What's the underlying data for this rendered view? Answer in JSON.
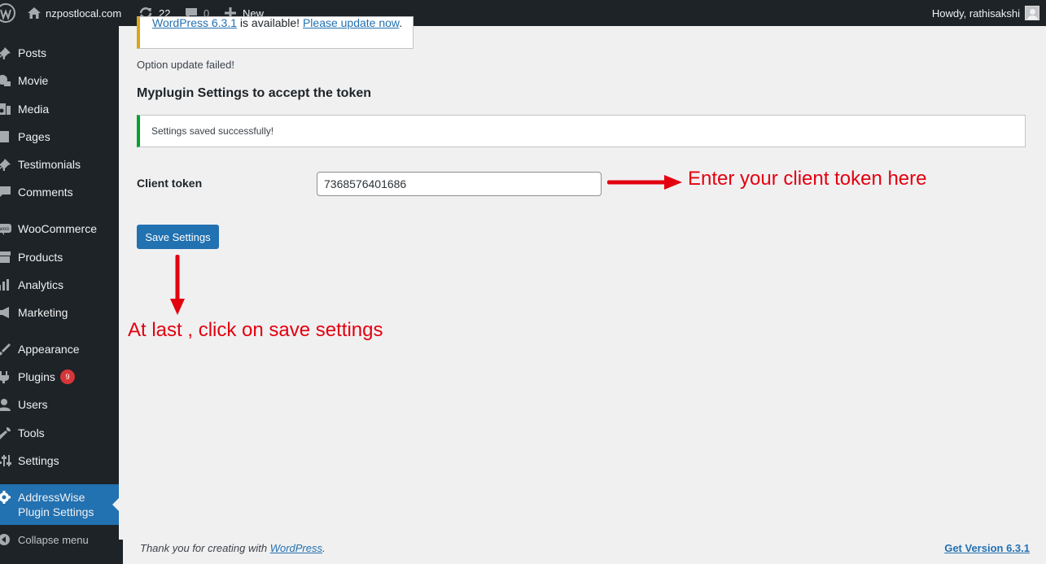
{
  "admin_bar": {
    "site_name": "nzpostlocal.com",
    "updates_count": "22",
    "comments_count": "0",
    "new_label": "New",
    "howdy": "Howdy, rathisakshi"
  },
  "sidebar": {
    "items": [
      {
        "label": "Posts",
        "icon": "pin-icon"
      },
      {
        "label": "Movie",
        "icon": "video-icon"
      },
      {
        "label": "Media",
        "icon": "media-icon"
      },
      {
        "label": "Pages",
        "icon": "pages-icon"
      },
      {
        "label": "Testimonials",
        "icon": "pin-icon"
      },
      {
        "label": "Comments",
        "icon": "comment-icon"
      },
      {
        "label": "WooCommerce",
        "icon": "woo-icon"
      },
      {
        "label": "Products",
        "icon": "archive-icon"
      },
      {
        "label": "Analytics",
        "icon": "chart-icon"
      },
      {
        "label": "Marketing",
        "icon": "megaphone-icon"
      },
      {
        "label": "Appearance",
        "icon": "brush-icon"
      },
      {
        "label": "Plugins",
        "icon": "plug-icon",
        "badge": "9"
      },
      {
        "label": "Users",
        "icon": "user-icon"
      },
      {
        "label": "Tools",
        "icon": "wrench-icon"
      },
      {
        "label": "Settings",
        "icon": "sliders-icon"
      },
      {
        "label": "AddressWise Plugin Settings",
        "icon": "gear-icon",
        "current": true
      }
    ],
    "collapse_label": "Collapse menu"
  },
  "main": {
    "nag": {
      "version_link": "WordPress 6.3.1",
      "middle_text": " is available! ",
      "update_link": "Please update now",
      "end_text": "."
    },
    "option_failed": "Option update failed!",
    "title": "Myplugin Settings to accept the token",
    "notice": "Settings saved successfully!",
    "field_label": "Client token",
    "token_value": "7368576401686",
    "save_label": "Save Settings",
    "annotation_1": "Enter your client token here",
    "annotation_2": "At last , click on save settings",
    "footer_text": "Thank you for creating with ",
    "footer_link": "WordPress",
    "footer_end": ".",
    "footer_version": "Get Version 6.3.1"
  },
  "colors": {
    "admin_dark": "#1d2327",
    "accent_blue": "#2271b1",
    "annotation_red": "#e3000f",
    "success_green": "#00a32a",
    "warning_yellow": "#dba617",
    "badge_red": "#d63638"
  }
}
